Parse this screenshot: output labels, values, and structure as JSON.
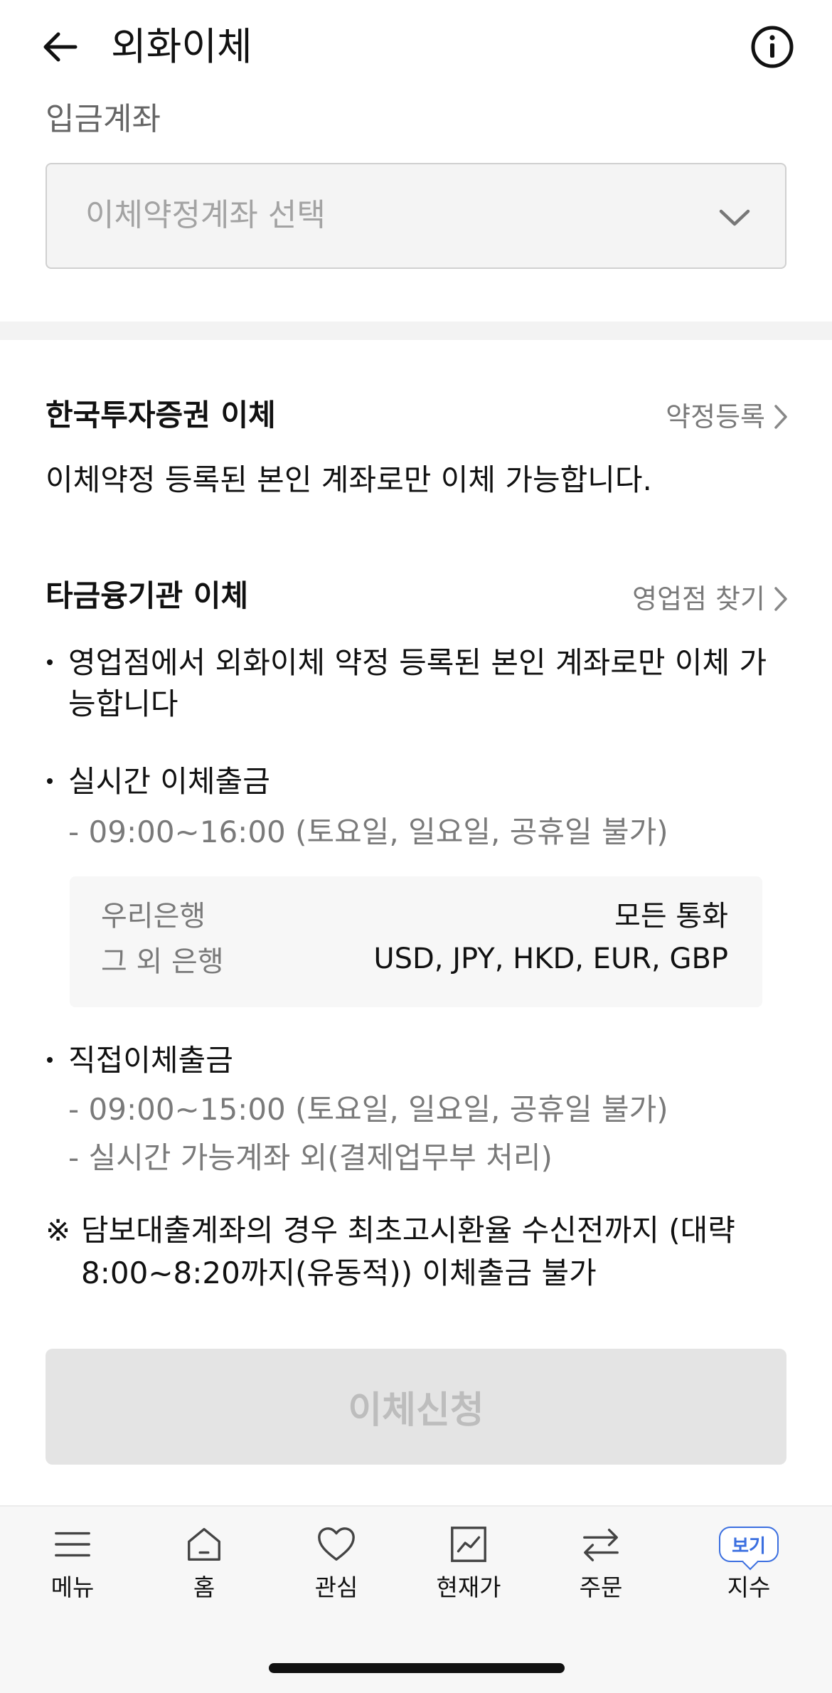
{
  "header": {
    "title": "외화이체",
    "back_icon": "arrow-left-icon",
    "info_icon": "info-circle-icon"
  },
  "deposit": {
    "label": "입금계좌",
    "select_placeholder": "이체약정계좌 선택"
  },
  "korea_transfer": {
    "title": "한국투자증권 이체",
    "link": "약정등록",
    "description": "이체약정 등록된 본인 계좌로만 이체 가능합니다."
  },
  "other_transfer": {
    "title": "타금융기관 이체",
    "link": "영업점 찾기",
    "bullet1": "영업점에서 외화이체 약정 등록된 본인 계좌로만 이체 가능합니다",
    "realtime": {
      "title": "실시간 이체출금",
      "hours": "- 09:00~16:00 (토요일, 일요일, 공휴일 불가)",
      "banks": [
        {
          "name": "우리은행",
          "currencies": "모든 통화"
        },
        {
          "name": "그 외 은행",
          "currencies": "USD, JPY, HKD, EUR, GBP"
        }
      ]
    },
    "direct": {
      "title": "직접이체출금",
      "hours": "- 09:00~15:00 (토요일, 일요일, 공휴일 불가)",
      "note": "- 실시간 가능계좌 외(결제업무부 처리)"
    }
  },
  "notice": {
    "mark": "※",
    "text": "담보대출계좌의 경우 최초고시환율 수신전까지 (대략 8:00~8:20까지(유동적)) 이체출금 불가"
  },
  "apply_button": "이체신청",
  "bottom_nav": [
    {
      "label": "메뉴",
      "icon": "hamburger-menu-icon"
    },
    {
      "label": "홈",
      "icon": "home-icon"
    },
    {
      "label": "관심",
      "icon": "heart-icon"
    },
    {
      "label": "현재가",
      "icon": "chart-icon"
    },
    {
      "label": "주문",
      "icon": "swap-arrows-icon"
    },
    {
      "label": "지수",
      "badge": "보기"
    }
  ],
  "colors": {
    "accent": "#3b6fe0",
    "muted_text": "#7a7a7a",
    "disabled_button": "#e4e4e4"
  }
}
